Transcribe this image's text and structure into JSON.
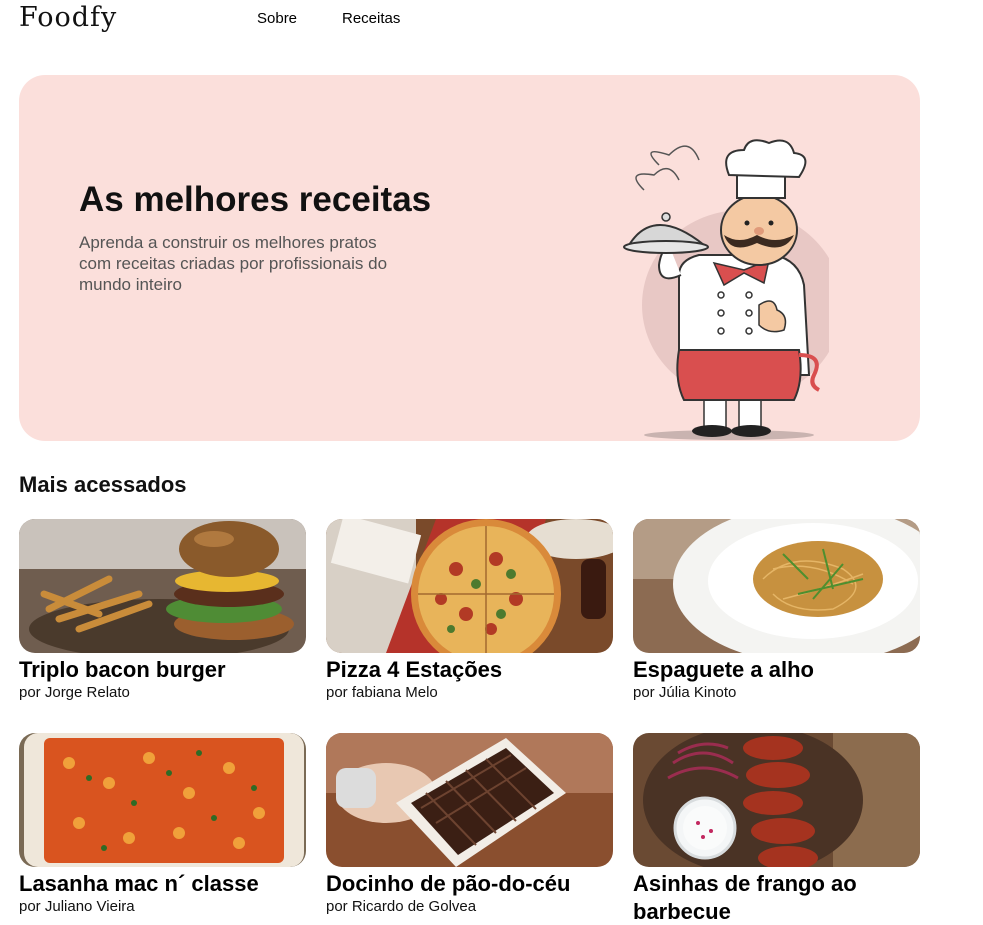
{
  "header": {
    "logo": "Foodfy",
    "nav": [
      {
        "label": "Sobre"
      },
      {
        "label": "Receitas"
      }
    ]
  },
  "hero": {
    "title": "As melhores receitas",
    "subtitle": "Aprenda a construir os melhores pratos com receitas criadas por profissionais do mundo inteiro",
    "background_color": "#fbdfdb"
  },
  "section": {
    "title": "Mais acessados"
  },
  "recipes": [
    {
      "title": "Triplo bacon burger",
      "author": "por Jorge Relato",
      "image": "burger-photo"
    },
    {
      "title": "Pizza 4 Estações",
      "author": "por fabiana Melo",
      "image": "pizza-photo"
    },
    {
      "title": "Espaguete a alho",
      "author": "por Júlia Kinoto",
      "image": "spaghetti-photo"
    },
    {
      "title": "Lasanha mac n´ classe",
      "author": "por Juliano Vieira",
      "image": "lasagna-photo"
    },
    {
      "title": "Docinho de pão-do-céu",
      "author": "por Ricardo de Golvea",
      "image": "chocolates-photo"
    },
    {
      "title": "Asinhas de frango ao barbecue",
      "author": "",
      "image": "chicken-wings-photo"
    }
  ]
}
